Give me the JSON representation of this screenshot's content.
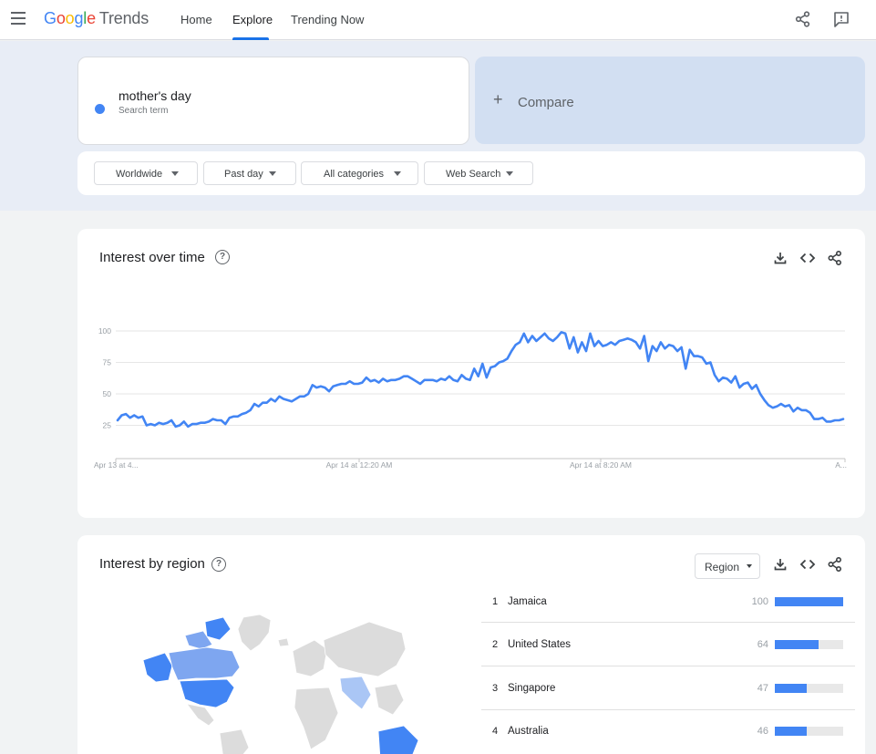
{
  "header": {
    "logo_google": [
      "G",
      "o",
      "o",
      "g",
      "l",
      "e"
    ],
    "logo_trends": "Trends",
    "nav": [
      {
        "label": "Home"
      },
      {
        "label": "Explore"
      },
      {
        "label": "Trending Now"
      }
    ],
    "active_tab": "Explore",
    "icons": [
      "menu-icon",
      "share-icon",
      "feedback-icon"
    ]
  },
  "search": {
    "term": "mother's day",
    "term_type": "Search term",
    "term_color": "#4285f4",
    "compare_label": "Compare",
    "compare_icon": "plus-icon"
  },
  "filters": [
    {
      "label": "Worldwide"
    },
    {
      "label": "Past day"
    },
    {
      "label": "All categories"
    },
    {
      "label": "Web Search"
    }
  ],
  "interest_over_time": {
    "title": "Interest over time",
    "help": "?",
    "tools": [
      "download-icon",
      "embed-icon",
      "share-icon"
    ]
  },
  "chart_data": {
    "type": "line",
    "yticks": [
      "100",
      "75",
      "50",
      "25"
    ],
    "ylim": [
      0,
      100
    ],
    "grid": true,
    "xticks": [
      "Apr 13 at 4...",
      "Apr 14 at 12:20 AM",
      "Apr 14 at 8:20 AM",
      "A..."
    ],
    "series": [
      {
        "color": "#4285f4",
        "values": [
          29,
          33,
          34,
          31,
          33,
          31,
          32,
          25,
          26,
          25,
          27,
          26,
          27,
          29,
          24,
          25,
          28,
          24,
          26,
          26,
          27,
          27,
          28,
          30,
          29,
          29,
          26,
          31,
          32,
          32,
          34,
          35,
          37,
          42,
          40,
          43,
          43,
          46,
          44,
          48,
          46,
          45,
          44,
          46,
          48,
          48,
          50,
          57,
          55,
          56,
          55,
          52,
          56,
          57,
          58,
          58,
          60,
          58,
          58,
          59,
          63,
          60,
          61,
          59,
          62,
          60,
          61,
          61,
          62,
          64,
          64,
          62,
          60,
          58,
          61,
          61,
          61,
          60,
          62,
          61,
          64,
          61,
          60,
          65,
          62,
          61,
          70,
          64,
          74,
          63,
          71,
          72,
          75,
          76,
          78,
          84,
          89,
          91,
          98,
          91,
          96,
          92,
          95,
          98,
          94,
          92,
          95,
          99,
          98,
          86,
          95,
          83,
          91,
          84,
          98,
          88,
          92,
          88,
          89,
          91,
          89,
          92,
          93,
          94,
          93,
          91,
          86,
          96,
          76,
          88,
          84,
          91,
          86,
          89,
          88,
          84,
          87,
          70,
          85,
          80,
          80,
          79,
          74,
          75,
          65,
          60,
          63,
          62,
          59,
          64,
          55,
          58,
          59,
          54,
          57,
          50,
          45,
          41,
          39,
          40,
          42,
          40,
          41,
          36,
          39,
          37,
          37,
          35,
          30,
          30,
          31,
          28,
          28,
          29,
          29,
          30
        ]
      }
    ]
  },
  "interest_by_region": {
    "title": "Interest by region",
    "help": "?",
    "select_label": "Region",
    "tools": [
      "download-icon",
      "embed-icon",
      "share-icon"
    ],
    "rows": [
      {
        "rank": "1",
        "name": "Jamaica",
        "value": "100",
        "fraction": 1.0
      },
      {
        "rank": "2",
        "name": "United States",
        "value": "64",
        "fraction": 0.64
      },
      {
        "rank": "3",
        "name": "Singapore",
        "value": "47",
        "fraction": 0.47
      },
      {
        "rank": "4",
        "name": "Australia",
        "value": "46",
        "fraction": 0.46
      }
    ],
    "map_colors": {
      "high": "#4285f4",
      "mid": "#7ea6f0",
      "low": "#aac6f5",
      "none": "#dcdcdc"
    }
  }
}
